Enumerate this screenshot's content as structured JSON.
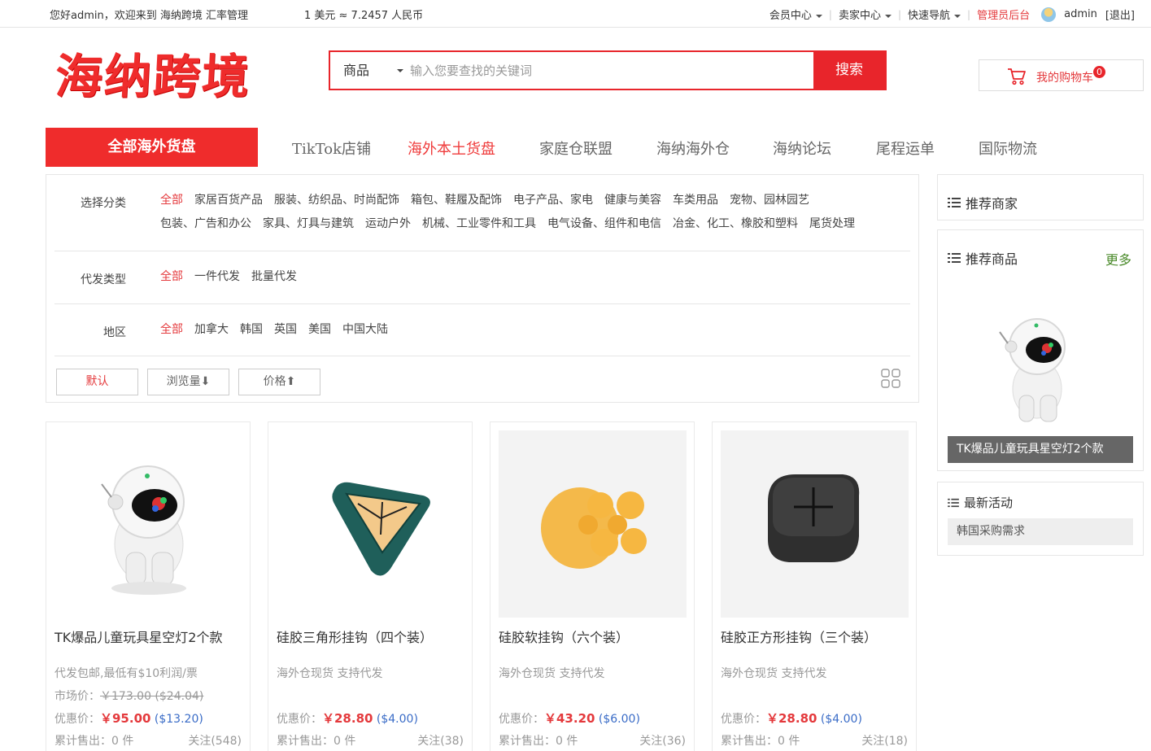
{
  "topbar": {
    "welcome": "您好admin，欢迎来到 海纳跨境 汇率管理",
    "rate": "1 美元 ≈ 7.2457 人民币",
    "member_center": "会员中心",
    "seller_center": "卖家中心",
    "quick_nav": "快速导航",
    "admin_backend": "管理员后台",
    "username": "admin",
    "logout": "[退出]"
  },
  "header": {
    "logo_text": "海纳跨境",
    "search": {
      "category": "商品",
      "placeholder": "输入您要查找的关键词",
      "button": "搜索"
    },
    "cart": {
      "label": "我的购物车",
      "count": "0"
    }
  },
  "nav": {
    "all_label": "全部海外货盘",
    "items": [
      "TikTok店铺",
      "海外本土货盘",
      "家庭仓联盟",
      "海纳海外仓",
      "海纳论坛",
      "尾程运单",
      "国际物流"
    ]
  },
  "filters": {
    "category": {
      "label": "选择分类",
      "options": [
        "全部",
        "家居百货产品",
        "服装、纺织品、时尚配饰",
        "箱包、鞋履及配饰",
        "电子产品、家电",
        "健康与美容",
        "车类用品",
        "宠物、园林园艺",
        "包装、广告和办公",
        "家具、灯具与建筑",
        "运动户外",
        "机械、工业零件和工具",
        "电气设备、组件和电信",
        "冶金、化工、橡胶和塑料",
        "尾货处理"
      ]
    },
    "dropship": {
      "label": "代发类型",
      "options": [
        "全部",
        "一件代发",
        "批量代发"
      ]
    },
    "region": {
      "label": "地区",
      "options": [
        "全部",
        "加拿大",
        "韩国",
        "英国",
        "美国",
        "中国大陆"
      ]
    },
    "sort": {
      "default": "默认",
      "views": "浏览量⬇",
      "price": "价格⬆"
    }
  },
  "products": [
    {
      "name": "TK爆品儿童玩具星空灯2个款",
      "desc": "代发包邮,最低有$10利润/票",
      "market_label": "市场价：",
      "market_price": "￥173.00 ($24.04)",
      "price_label": "优惠价：",
      "price": "￥95.00",
      "price_usd": "($13.20)",
      "sold": "累计售出：0 件",
      "follow": "关注(548)",
      "image": "astronaut-toy"
    },
    {
      "name": "硅胶三角形挂钩（四个装）",
      "desc": "海外仓现货 支持代发",
      "price_label": "优惠价：",
      "price": "￥28.80",
      "price_usd": "($4.00)",
      "sold": "累计售出：0 件",
      "follow": "关注(38)",
      "image": "triangle-hook"
    },
    {
      "name": "硅胶软挂钩（六个装）",
      "desc": "海外仓现货 支持代发",
      "price_label": "优惠价：",
      "price": "￥43.20",
      "price_usd": "($6.00)",
      "sold": "累计售出：0 件",
      "follow": "关注(36)",
      "image": "orange-hook"
    },
    {
      "name": "硅胶正方形挂钩（三个装）",
      "desc": "海外仓现货 支持代发",
      "price_label": "优惠价：",
      "price": "￥28.80",
      "price_usd": "($4.00)",
      "sold": "累计售出：0 件",
      "follow": "关注(18)",
      "image": "square-hook"
    }
  ],
  "sidebar": {
    "recommended_merchants": "推荐商家",
    "recommended_products": "推荐商品",
    "more": "更多",
    "featured_caption": "TK爆品儿童玩具星空灯2个款",
    "latest_events": "最新活动",
    "event_item": "韩国采购需求"
  },
  "colors": {
    "brand_red": "#e8252b",
    "price_red": "#e4393c",
    "usd_blue": "#3a6cc7",
    "more_green": "#4a8a2a"
  }
}
